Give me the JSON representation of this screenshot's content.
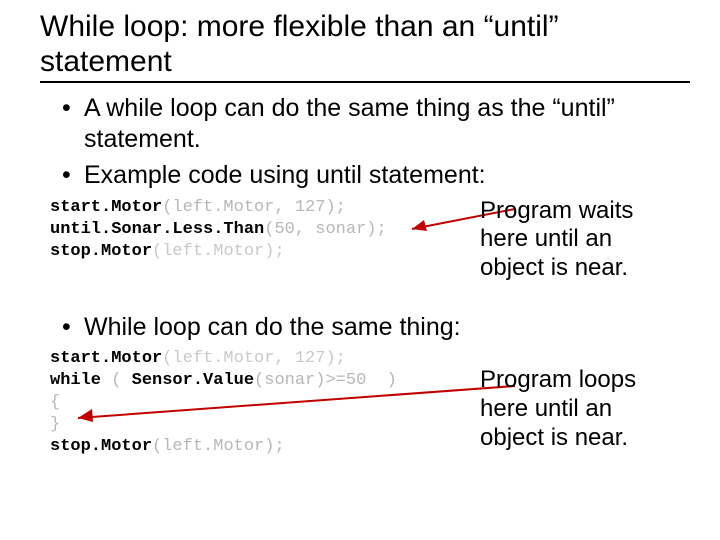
{
  "title": "While loop: more flexible than an “until” statement",
  "bullets": {
    "b1": "A while loop can do the same thing as the “until” statement.",
    "b2": "Example code using until statement:",
    "b3": "While loop can do the same thing:"
  },
  "code1": {
    "l1a": "start.Motor",
    "l1b": "(left.Motor, 127);",
    "l2a": "until.Sonar.Less.Than",
    "l2b": "(50, sonar);",
    "l3a": "stop.Motor",
    "l3b": "(left.Motor);"
  },
  "code2": {
    "l1a": "start.Motor",
    "l1b": "(left.Motor, 127);",
    "l2a": "while",
    "l2b": " ( ",
    "l2c": "Sensor.Value",
    "l2d": "(sonar)>=50  )",
    "l3": "{",
    "l4": "}",
    "l5a": "stop.Motor",
    "l5b": "(left.Motor);"
  },
  "callouts": {
    "c1": "Program waits here until an object is near.",
    "c2": "Program loops here until an object is near."
  }
}
